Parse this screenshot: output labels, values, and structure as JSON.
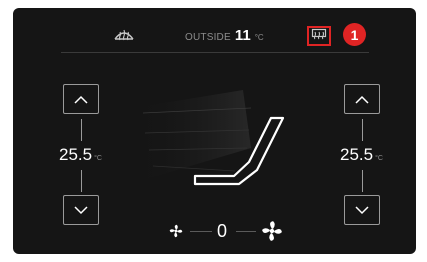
{
  "header": {
    "outside_label": "OUTSIDE",
    "outside_temp": "11",
    "outside_unit": "°C",
    "callout_number": "1"
  },
  "left_zone": {
    "temperature": "25.5",
    "unit": "°C"
  },
  "right_zone": {
    "temperature": "25.5",
    "unit": "°C"
  },
  "fan": {
    "speed": "0"
  },
  "icons": {
    "front_defrost": "front-defrost-icon",
    "rear_defrost": "rear-defrost-icon",
    "up": "chevron-up-icon",
    "down": "chevron-down-icon",
    "fan_low": "fan-low-icon",
    "fan_high": "fan-high-icon",
    "seat": "seat-airflow-icon"
  },
  "colors": {
    "background": "#151515",
    "highlight": "#e02424",
    "text": "#ffffff",
    "muted": "#8c8c8c"
  }
}
